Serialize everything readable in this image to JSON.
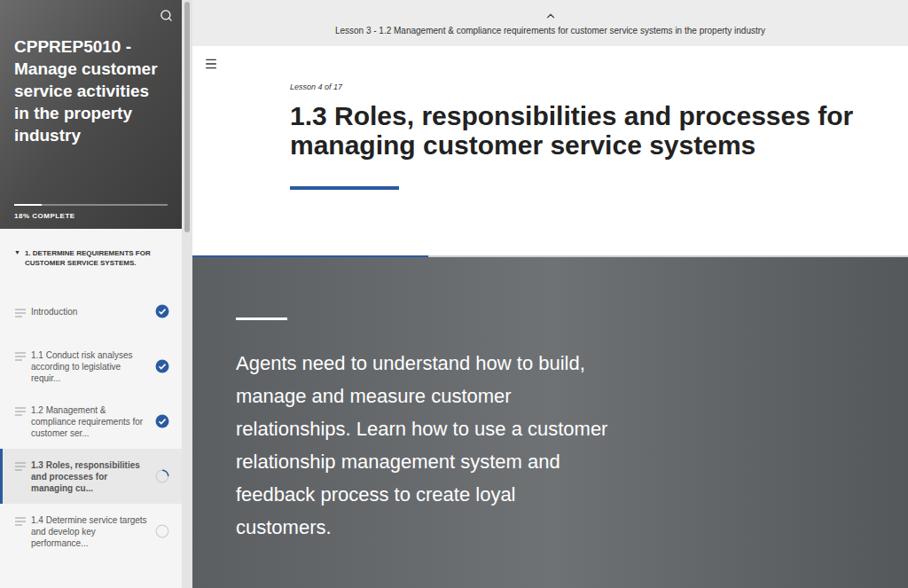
{
  "sidebar": {
    "title": "CPPREP5010 - Manage customer service activities in the property industry",
    "progress": {
      "level": 0.18,
      "label": "18% COMPLETE"
    },
    "section": {
      "toggle": "▼",
      "title": "1. DETERMINE REQUIREMENTS FOR CUSTOMER SERVICE SYSTEMS.",
      "expanded": true
    },
    "items": [
      {
        "label": "Introduction",
        "complete": true,
        "in_progress": false,
        "selected": false
      },
      {
        "label": "1.1 Conduct risk analyses according to legislative requir...",
        "complete": true,
        "in_progress": false,
        "selected": false
      },
      {
        "label": "1.2 Management & compliance requirements for customer ser...",
        "complete": true,
        "in_progress": false,
        "selected": false
      },
      {
        "label": "1.3 Roles, responsibilities and processes for managing cu...",
        "complete": false,
        "in_progress": true,
        "selected": true
      },
      {
        "label": "1.4 Determine service targets and develop key performance...",
        "complete": false,
        "in_progress": false,
        "selected": false
      }
    ]
  },
  "top_bar": {
    "previous_lesson": "Lesson 3 - 1.2 Management & compliance requirements for customer service systems in the property industry"
  },
  "lesson": {
    "counter": "Lesson 4 of 17",
    "title": "1.3 Roles, responsibilities and processes for managing customer service systems",
    "progress": 0.33
  },
  "hero": {
    "text": "Agents need to understand how to build, manage and measure customer relationships. Learn how to use a customer relationship management system and feedback process to create loyal customers."
  }
}
